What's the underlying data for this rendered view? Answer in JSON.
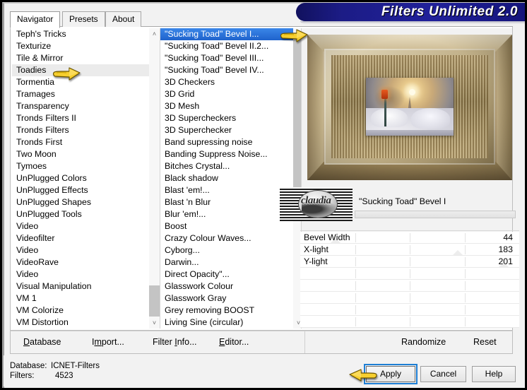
{
  "window": {
    "title": "Filters Unlimited 2.0"
  },
  "tabs": [
    {
      "label": "Navigator",
      "active": true
    },
    {
      "label": "Presets",
      "active": false
    },
    {
      "label": "About",
      "active": false
    }
  ],
  "category_list": {
    "items": [
      {
        "label": "Teph's Tricks"
      },
      {
        "label": "Texturize"
      },
      {
        "label": "Tile & Mirror"
      },
      {
        "label": "Toadies",
        "hovered": true
      },
      {
        "label": "Tormentia"
      },
      {
        "label": "Tramages"
      },
      {
        "label": "Transparency"
      },
      {
        "label": "Tronds Filters II"
      },
      {
        "label": "Tronds Filters"
      },
      {
        "label": "Tronds First"
      },
      {
        "label": "Two Moon"
      },
      {
        "label": "Tymoes"
      },
      {
        "label": "UnPlugged Colors"
      },
      {
        "label": "UnPlugged Effects"
      },
      {
        "label": "UnPlugged Shapes"
      },
      {
        "label": "UnPlugged Tools"
      },
      {
        "label": "Video"
      },
      {
        "label": "Videofilter"
      },
      {
        "label": "Video"
      },
      {
        "label": "VideoRave"
      },
      {
        "label": "Video"
      },
      {
        "label": "Visual Manipulation"
      },
      {
        "label": "VM 1"
      },
      {
        "label": "VM Colorize"
      },
      {
        "label": "VM Distortion"
      }
    ]
  },
  "filter_list": {
    "items": [
      {
        "label": "\"Sucking Toad\" Bevel I...",
        "selected": true
      },
      {
        "label": "\"Sucking Toad\" Bevel II.2..."
      },
      {
        "label": "\"Sucking Toad\" Bevel III..."
      },
      {
        "label": "\"Sucking Toad\" Bevel IV..."
      },
      {
        "label": "3D Checkers"
      },
      {
        "label": "3D Grid"
      },
      {
        "label": "3D Mesh"
      },
      {
        "label": "3D Supercheckers"
      },
      {
        "label": "3D Superchecker"
      },
      {
        "label": "Band supressing noise"
      },
      {
        "label": "Banding Suppress Noise..."
      },
      {
        "label": "Bitches Crystal..."
      },
      {
        "label": "Black shadow"
      },
      {
        "label": "Blast 'em!..."
      },
      {
        "label": "Blast 'n Blur"
      },
      {
        "label": "Blur 'em!..."
      },
      {
        "label": "Boost"
      },
      {
        "label": "Crazy Colour Waves..."
      },
      {
        "label": "Cyborg..."
      },
      {
        "label": "Darwin..."
      },
      {
        "label": "Direct Opacity\"..."
      },
      {
        "label": "Glasswork Colour"
      },
      {
        "label": "Glasswork Gray"
      },
      {
        "label": "Grey removing BOOST"
      },
      {
        "label": "Living Sine (circular)"
      }
    ]
  },
  "preview": {
    "watermark_text": "claudia",
    "filter_title": "\"Sucking Toad\"  Bevel I"
  },
  "sliders": [
    {
      "label": "Bevel Width",
      "value": "44",
      "pos": 16
    },
    {
      "label": "X-light",
      "value": "183",
      "pos": 72
    },
    {
      "label": "Y-light",
      "value": "201",
      "pos": 93
    },
    {
      "label": "",
      "value": "",
      "pos": -1
    },
    {
      "label": "",
      "value": "",
      "pos": -1
    },
    {
      "label": "",
      "value": "",
      "pos": -1
    },
    {
      "label": "",
      "value": "",
      "pos": -1
    },
    {
      "label": "",
      "value": "",
      "pos": -1
    }
  ],
  "command_bar": {
    "database": "Database",
    "import": "Import...",
    "filter_info": "Filter Info...",
    "editor": "Editor...",
    "randomize": "Randomize",
    "reset": "Reset"
  },
  "status": {
    "database_key": "Database:",
    "database_value": "ICNET-Filters",
    "filters_key": "Filters:",
    "filters_value": "4523"
  },
  "buttons": {
    "apply": "Apply",
    "cancel": "Cancel",
    "help": "Help"
  },
  "colors": {
    "title_banner": "#1b1b7a",
    "selection": "#2a6fd6",
    "focus_ring": "#1f7fd4",
    "hand": "#f5c518",
    "panel": "#f2f2f2"
  },
  "icons": {
    "scroll_up": "˄",
    "scroll_down": "˅"
  }
}
